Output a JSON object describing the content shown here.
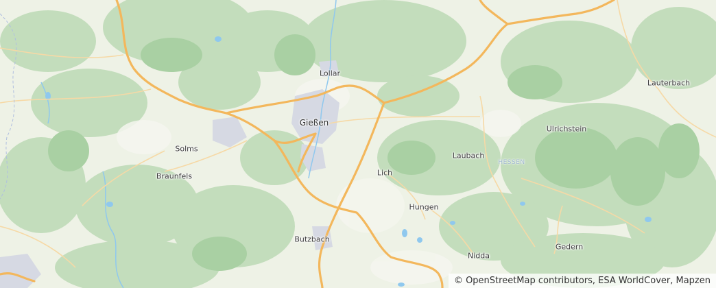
{
  "map": {
    "places": [
      {
        "name": "Lollar",
        "kind": "town"
      },
      {
        "name": "Gießen",
        "kind": "city"
      },
      {
        "name": "Solms",
        "kind": "town"
      },
      {
        "name": "Braunfels",
        "kind": "town"
      },
      {
        "name": "Lich",
        "kind": "town"
      },
      {
        "name": "Laubach",
        "kind": "town"
      },
      {
        "name": "Ulrichstein",
        "kind": "town"
      },
      {
        "name": "Lauterbach",
        "kind": "town"
      },
      {
        "name": "Hungen",
        "kind": "town"
      },
      {
        "name": "Butzbach",
        "kind": "town"
      },
      {
        "name": "Gedern",
        "kind": "town"
      },
      {
        "name": "Nidda",
        "kind": "town"
      },
      {
        "name": "HESSEN",
        "kind": "region"
      }
    ],
    "attribution": "© OpenStreetMap contributors, ESA WorldCover, Mapzen",
    "colors": {
      "land": "#eef2e6",
      "forest": "#bcd9b6",
      "forest_dark": "#9cc79a",
      "urban": "#d5d8e2",
      "motorway": "#f3b75c",
      "road": "#f6d9a6",
      "water": "#8fc8ee",
      "border": "#9fb3d6"
    }
  }
}
